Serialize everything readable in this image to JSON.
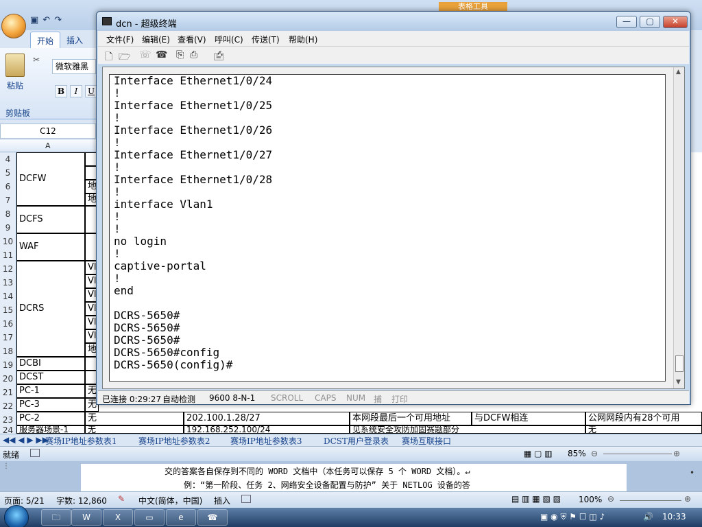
{
  "excel": {
    "title_right": "表格工具",
    "tabs": [
      "开始",
      "插入"
    ],
    "font_name": "微软雅黑",
    "paste_label": "粘贴",
    "clipboard_label": "剪贴板",
    "bold": "B",
    "italic": "I",
    "underline": "U",
    "name_box": "C12",
    "col_a": "A",
    "rows": [
      {
        "n": "4"
      },
      {
        "n": "5"
      },
      {
        "n": "6"
      },
      {
        "n": "7"
      },
      {
        "n": "8"
      },
      {
        "n": "9"
      },
      {
        "n": "10"
      },
      {
        "n": "11"
      },
      {
        "n": "12"
      },
      {
        "n": "13"
      },
      {
        "n": "14"
      },
      {
        "n": "15"
      },
      {
        "n": "16"
      },
      {
        "n": "17"
      },
      {
        "n": "18"
      },
      {
        "n": "19"
      },
      {
        "n": "20"
      },
      {
        "n": "21"
      },
      {
        "n": "22"
      },
      {
        "n": "23"
      },
      {
        "n": "24"
      }
    ],
    "devices": [
      "DCFW",
      "DCFS",
      "WAF",
      "DCRS",
      "DCBI",
      "DCST",
      "PC-1",
      "PC-3",
      "PC-2",
      "服务器场景-1"
    ],
    "side_labels": [
      "地",
      "地",
      "Vl",
      "Vl",
      "Vl",
      "Vl",
      "Vl",
      "Vl",
      "地",
      "无",
      "无",
      "无",
      "无"
    ],
    "row23": {
      "b": "无",
      "c": "202.100.1.28/27",
      "d": "本网段最后一个可用地址",
      "e": "与DCFW相连",
      "f": "公网网段内有28个可用"
    },
    "row24": {
      "c": "192.168.252.100/24",
      "d": "见系统安全攻防加固赛题部分",
      "f": "无"
    },
    "sheet_tabs": [
      "赛场IP地址参数表1",
      "赛场IP地址参数表2",
      "赛场IP地址参数表3",
      "DCST用户登录表",
      "赛场互联接口"
    ],
    "status_ready": "就绪",
    "zoom": "85%"
  },
  "word": {
    "line1": "交的答案各自保存到不同的 WORD 文档中（本任务可以保存 5 个 WORD 文档）。↵",
    "line2": "例：“第一阶段、任务 2、网络安全设备配置与防护” 关于 NETLOG 设备的答",
    "status_page": "页面: 5/21",
    "status_words": "字数: 12,860",
    "status_lang": "中文(简体，中国)",
    "status_insert": "插入",
    "zoom": "100%"
  },
  "taskbar": {
    "clock": "10:33"
  },
  "terminal": {
    "title": "dcn - 超级终端",
    "menu": [
      "文件(F)",
      "编辑(E)",
      "查看(V)",
      "呼叫(C)",
      "传送(T)",
      "帮助(H)"
    ],
    "lines": [
      "Interface Ethernet1/0/24",
      "!",
      "Interface Ethernet1/0/25",
      "!",
      "Interface Ethernet1/0/26",
      "!",
      "Interface Ethernet1/0/27",
      "!",
      "Interface Ethernet1/0/28",
      "!",
      "interface Vlan1",
      "!",
      "!",
      "no login",
      "!",
      "captive-portal",
      "!",
      "end",
      "",
      "DCRS-5650#",
      "DCRS-5650#",
      "DCRS-5650#",
      "DCRS-5650#config",
      "DCRS-5650(config)#"
    ],
    "status": {
      "connected": "已连接 0:29:27",
      "detect": "自动检测",
      "params": "9600 8-N-1",
      "scroll": "SCROLL",
      "caps": "CAPS",
      "num": "NUM",
      "capture": "捕",
      "print": "打印"
    }
  }
}
